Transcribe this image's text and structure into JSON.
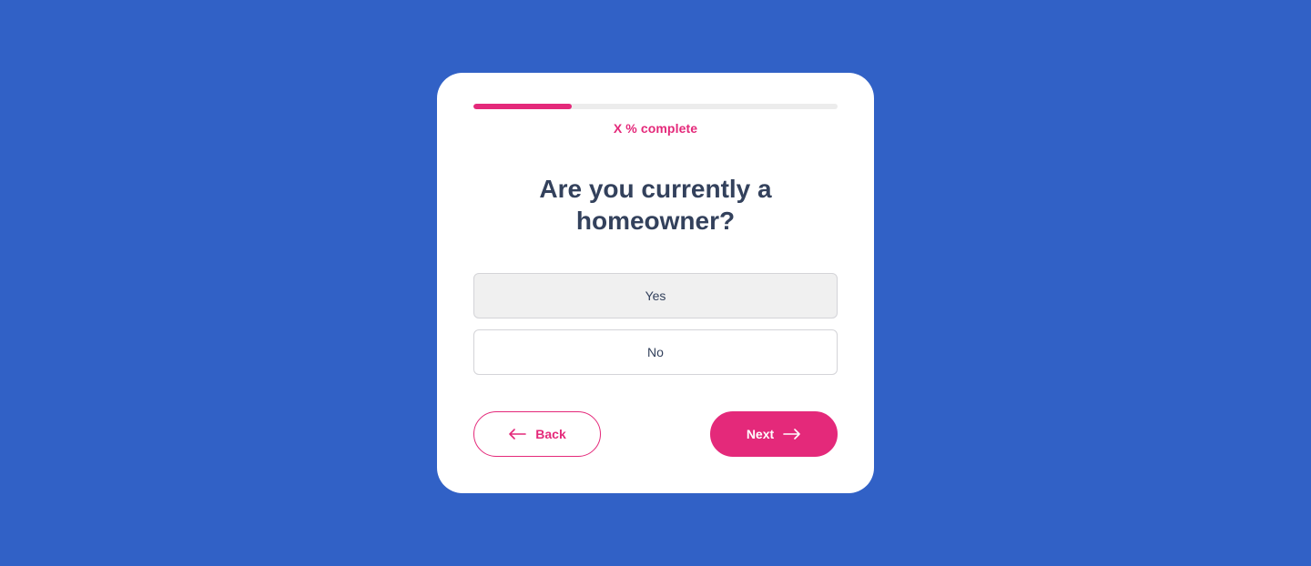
{
  "page": {
    "background_color": "#3161c6",
    "accent_color": "#e4297a",
    "text_color": "#33415c"
  },
  "progress": {
    "fraction": 0.27,
    "label": "X % complete"
  },
  "question": {
    "text": "Are you currently a homeowner?"
  },
  "options": [
    {
      "label": "Yes",
      "selected": true
    },
    {
      "label": "No",
      "selected": false
    }
  ],
  "navigation": {
    "back": {
      "label": "Back",
      "icon": "arrow-left-icon"
    },
    "next": {
      "label": "Next",
      "icon": "arrow-right-icon"
    }
  }
}
